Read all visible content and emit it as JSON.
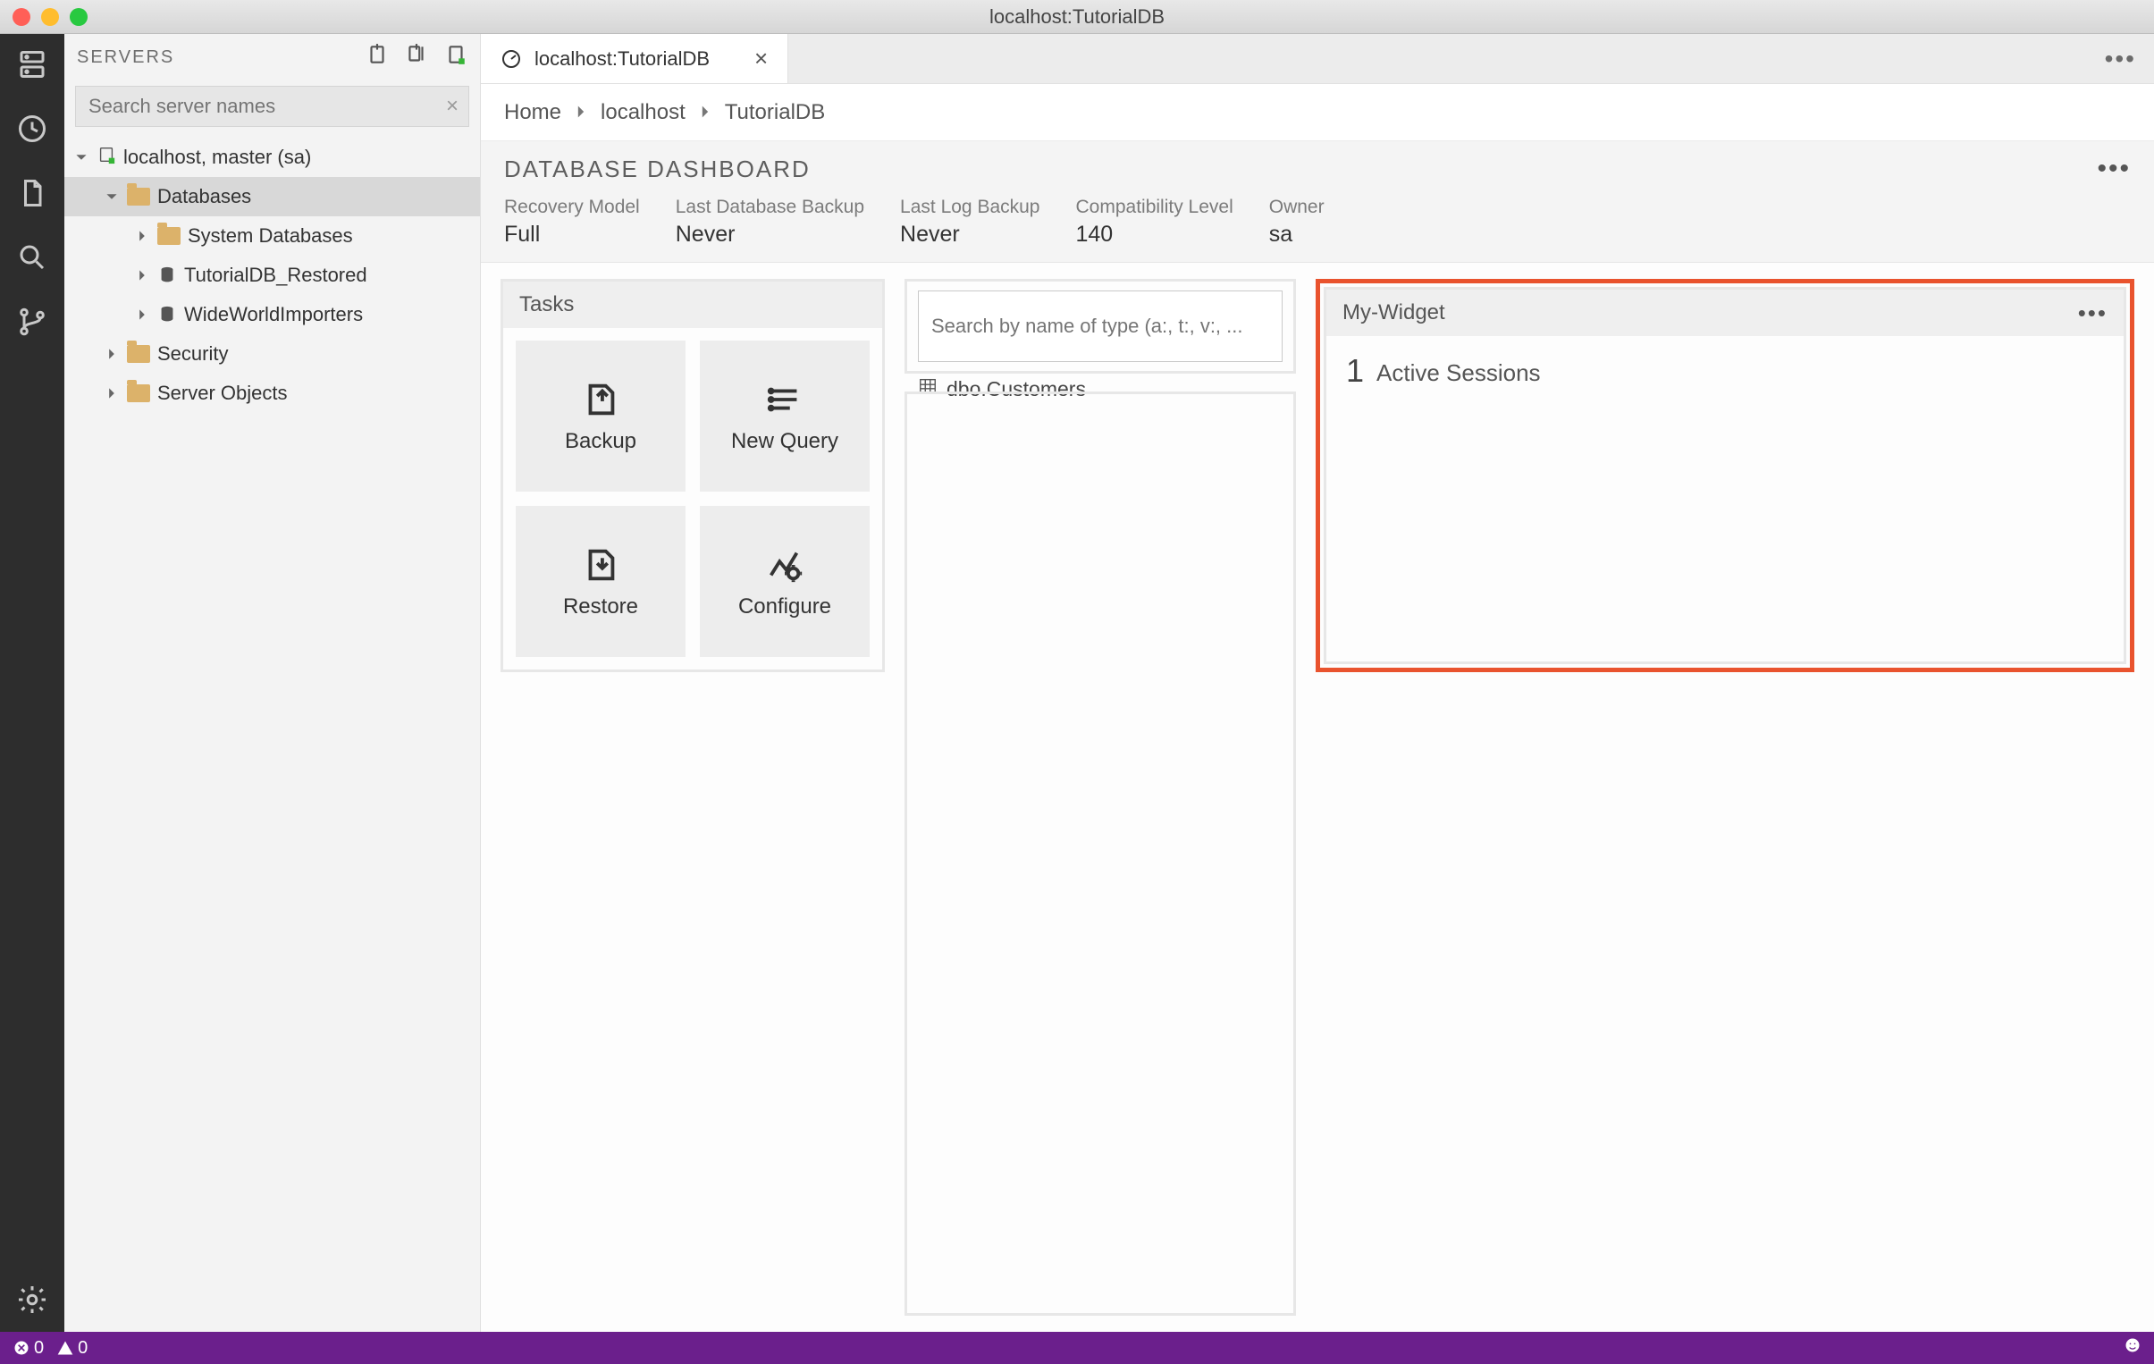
{
  "window": {
    "title": "localhost:TutorialDB"
  },
  "activitybar": {
    "items": [
      "servers",
      "history",
      "file",
      "search",
      "source-control"
    ],
    "bottom": "settings"
  },
  "sidebar": {
    "title": "SERVERS",
    "search_placeholder": "Search server names",
    "tree": {
      "server": "localhost, master (sa)",
      "databases_label": "Databases",
      "children": [
        "System Databases",
        "TutorialDB_Restored",
        "WideWorldImporters"
      ],
      "security_label": "Security",
      "server_objects_label": "Server Objects"
    }
  },
  "tab": {
    "label": "localhost:TutorialDB"
  },
  "breadcrumbs": [
    "Home",
    "localhost",
    "TutorialDB"
  ],
  "dashboard": {
    "title": "DATABASE DASHBOARD",
    "props": [
      {
        "label": "Recovery Model",
        "value": "Full"
      },
      {
        "label": "Last Database Backup",
        "value": "Never"
      },
      {
        "label": "Last Log Backup",
        "value": "Never"
      },
      {
        "label": "Compatibility Level",
        "value": "140"
      },
      {
        "label": "Owner",
        "value": "sa"
      }
    ]
  },
  "tasks": {
    "title": "Tasks",
    "items": [
      "Backup",
      "New Query",
      "Restore",
      "Configure"
    ]
  },
  "object_search": {
    "placeholder": "Search by name of type (a:, t:, v:, ...",
    "results": [
      "dbo.Customers"
    ]
  },
  "widget": {
    "title": "My-Widget",
    "count": "1",
    "label": "Active Sessions"
  },
  "statusbar": {
    "errors": "0",
    "warnings": "0"
  }
}
